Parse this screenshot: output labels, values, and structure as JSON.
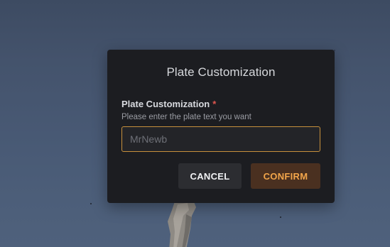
{
  "modal": {
    "title": "Plate Customization",
    "field_label": "Plate Customization",
    "required_mark": "*",
    "help_text": "Please enter the plate text you want",
    "input": {
      "value": "",
      "placeholder": "MrNewb"
    },
    "cancel_label": "CANCEL",
    "confirm_label": "CONFIRM"
  },
  "colors": {
    "accent": "#c7903c",
    "confirm_text": "#f2a54a",
    "confirm_bg": "#4a3020",
    "required": "#e0564f",
    "modal_bg": "#1c1d21"
  }
}
